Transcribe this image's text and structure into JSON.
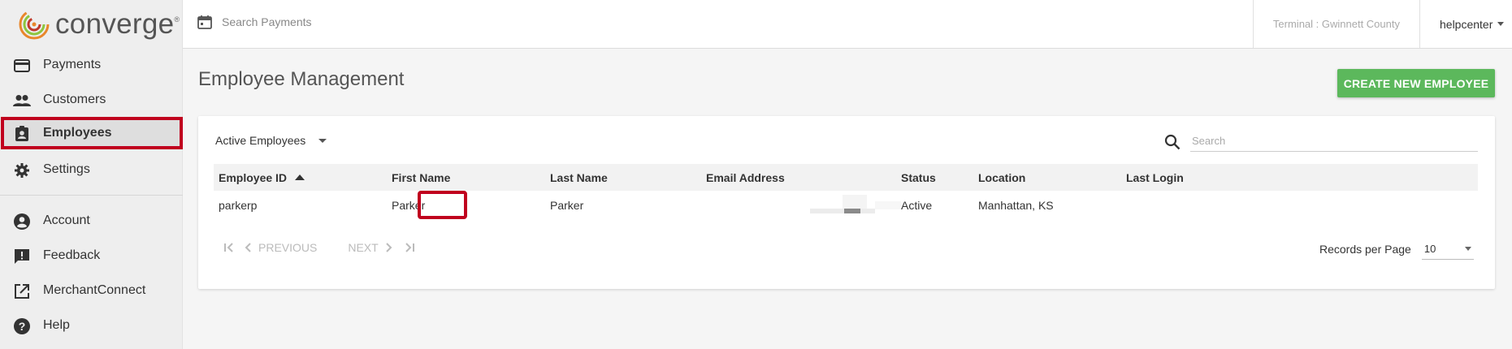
{
  "app": {
    "logo_text": "converge",
    "logo_tm": "®"
  },
  "sidebar": {
    "items": [
      {
        "label": "Payments",
        "icon": "credit-card-icon"
      },
      {
        "label": "Customers",
        "icon": "people-icon"
      },
      {
        "label": "Employees",
        "icon": "badge-icon",
        "active": true
      },
      {
        "label": "Settings",
        "icon": "gear-icon"
      },
      {
        "label": "Account",
        "icon": "account-circle-icon"
      },
      {
        "label": "Feedback",
        "icon": "feedback-icon"
      },
      {
        "label": "MerchantConnect",
        "icon": "open-external-icon"
      },
      {
        "label": "Help",
        "icon": "help-icon"
      }
    ]
  },
  "topbar": {
    "search_label": "Search Payments",
    "terminal": "Terminal : Gwinnett County",
    "user": "helpcenter"
  },
  "page": {
    "title": "Employee Management",
    "create_button": "CREATE NEW EMPLOYEE"
  },
  "table": {
    "filter": "Active Employees",
    "search_placeholder": "Search",
    "headers": [
      "Employee ID",
      "First Name",
      "Last Name",
      "Email Address",
      "Status",
      "Location",
      "Last Login"
    ],
    "rows": [
      {
        "employee_id": "parkerp",
        "first_name": "Parker",
        "last_name": "Parker",
        "email": "",
        "status": "Active",
        "location": "Manhattan, KS",
        "last_login": ""
      }
    ]
  },
  "pager": {
    "previous": "PREVIOUS",
    "next": "NEXT",
    "records_label": "Records per Page",
    "records_value": "10"
  },
  "colors": {
    "accent_red": "#c0001e",
    "button_green": "#5cb85c"
  }
}
